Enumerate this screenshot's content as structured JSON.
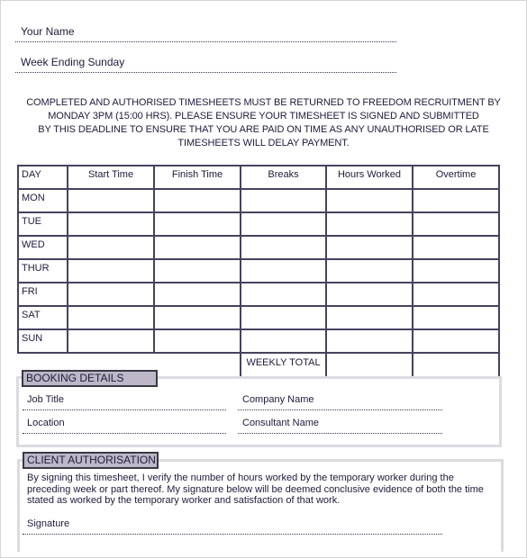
{
  "header": {
    "your_name_label": "Your Name",
    "week_ending_label": "Week Ending Sunday"
  },
  "notice": {
    "lines": [
      "COMPLETED AND AUTHORISED TIMESHEETS MUST BE RETURNED TO FREEDOM RECRUITMENT BY",
      "MONDAY 3PM (15:00 HRS).  PLEASE ENSURE YOUR TIMESHEET IS SIGNED AND SUBMITTED",
      "BY THIS DEADLINE TO ENSURE THAT YOU ARE PAID ON TIME AS ANY UNAUTHORISED OR LATE",
      "TIMESHEETS WILL DELAY PAYMENT."
    ]
  },
  "timesheet": {
    "columns": [
      "DAY",
      "Start Time",
      "Finish Time",
      "Breaks",
      "Hours Worked",
      "Overtime"
    ],
    "days": [
      "MON",
      "TUE",
      "WED",
      "THUR",
      "FRI",
      "SAT",
      "SUN"
    ],
    "weekly_total_label": "WEEKLY TOTAL"
  },
  "booking": {
    "title": "BOOKING DETAILS",
    "fields": [
      "Job Title",
      "Company Name",
      "Location",
      "Consultant Name"
    ]
  },
  "client_auth": {
    "title": "CLIENT AUTHORISATION",
    "text_lines": [
      "By signing this timesheet, I verify the number of hours worked by the temporary worker during the",
      "preceding week or part thereof.  My signature below will be deemed conclusive evidence of both the time",
      "stated as worked by the temporary worker and satisfaction of that work."
    ],
    "signature_label": "Signature"
  }
}
